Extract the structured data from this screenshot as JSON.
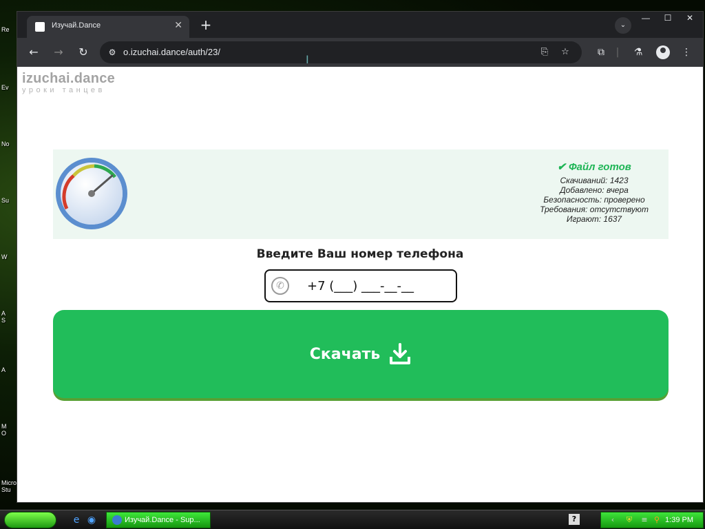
{
  "desktop": {
    "labels": [
      "Re",
      "Ev",
      "No",
      "Su",
      "W",
      "A\nS",
      "A",
      "M\nO",
      "Micro\nStu"
    ]
  },
  "browser": {
    "tab_title": "Изучай.Dance",
    "url": "o.izuchai.dance/auth/23/"
  },
  "page": {
    "logo_title": "izuchai.dance",
    "logo_subtitle": "уроки танцев",
    "status": {
      "title": "Файл готов",
      "lines": [
        "Скачиваний: 1423",
        "Добавлено: вчера",
        "Безопасность: проверено",
        "Требования: отсутствуют",
        "Играют: 1637"
      ]
    },
    "prompt": "Введите Ваш номер телефона",
    "phone_value": "+7 (___) ___-__-__",
    "download_label": "Скачать"
  },
  "taskbar": {
    "task_label": "Изучай.Dance - Sup...",
    "help_label": "?",
    "clock": "1:39 PM"
  },
  "colors": {
    "accent_green": "#21bd5a",
    "status_green": "#1fb556",
    "banner_bg": "#edf7f1"
  }
}
